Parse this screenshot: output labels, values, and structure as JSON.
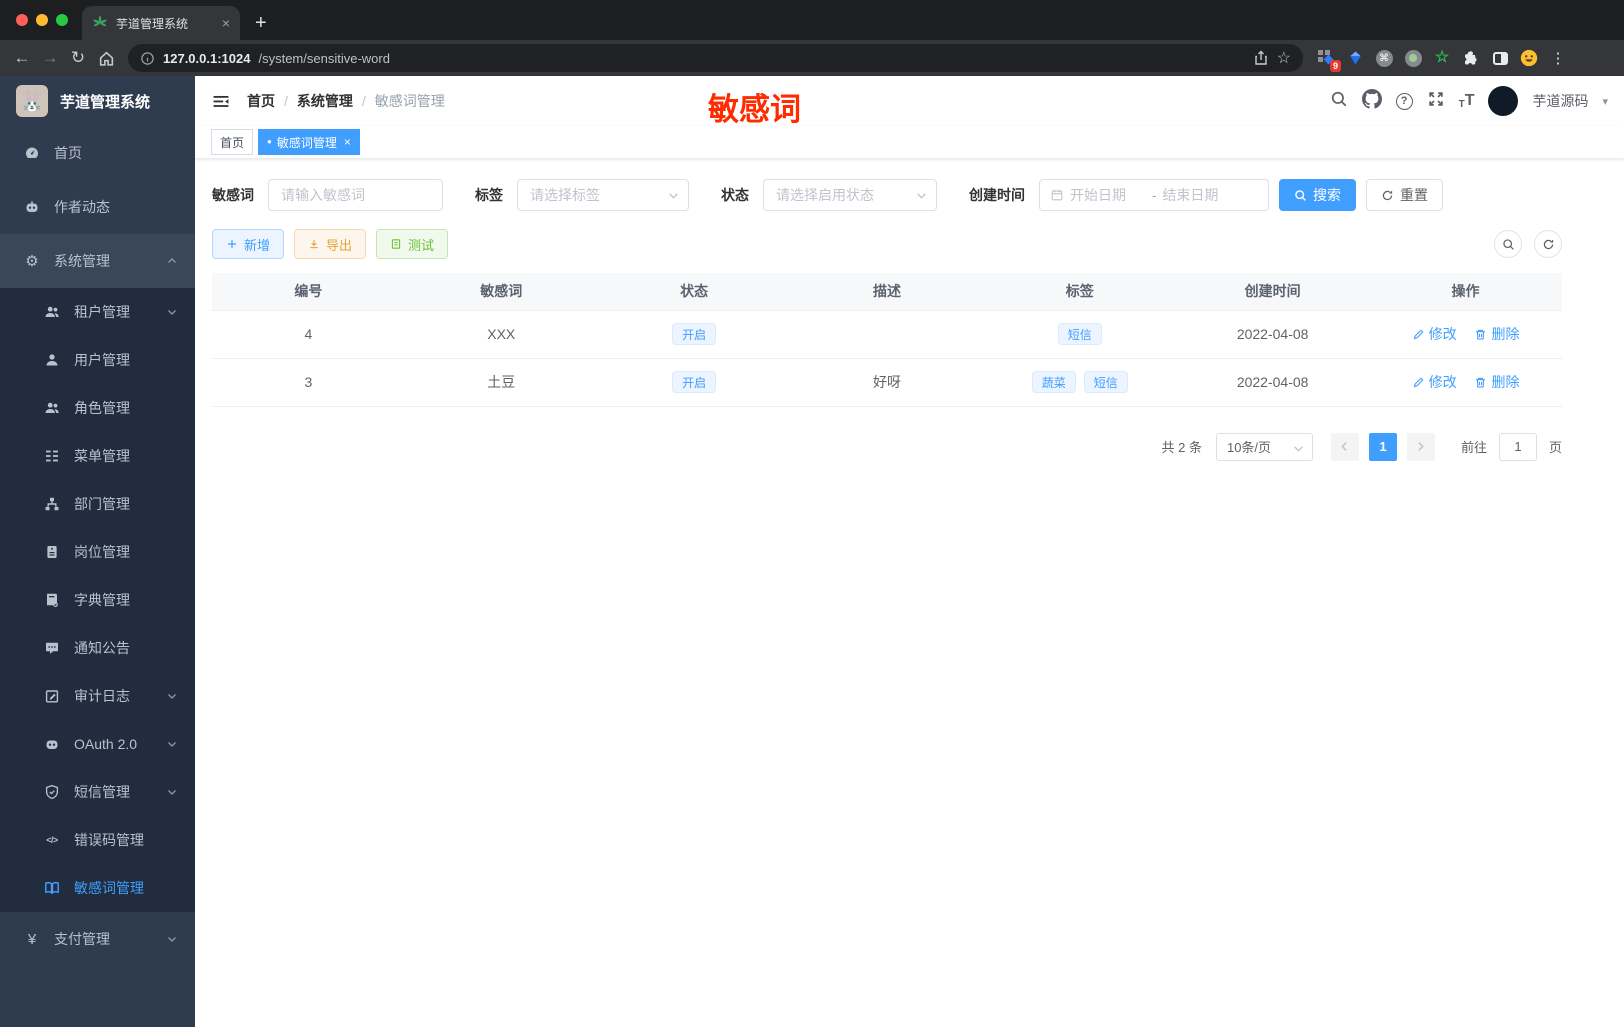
{
  "browser": {
    "tab_title": "芋道管理系统",
    "url_host": "127.0.0.1:1024",
    "url_path": "/system/sensitive-word",
    "extension_badge": "9"
  },
  "icons": {
    "back": "←",
    "forward": "→",
    "reload": "↻",
    "star": "☆",
    "ellipsis": "⋮",
    "new_tab": "+",
    "close": "×",
    "dot": "●",
    "gear": "⚙",
    "yen": "¥",
    "code": "</>",
    "command": "⌘",
    "green_star": "☆",
    "caret_down": "▾",
    "question": "?",
    "font_small": "T",
    "font_large": "T",
    "rabbit": "🐰"
  },
  "sidebar": {
    "app_title": "芋道管理系统",
    "items": [
      {
        "label": "首页"
      },
      {
        "label": "作者动态"
      },
      {
        "label": "系统管理"
      },
      {
        "label": "租户管理"
      },
      {
        "label": "用户管理"
      },
      {
        "label": "角色管理"
      },
      {
        "label": "菜单管理"
      },
      {
        "label": "部门管理"
      },
      {
        "label": "岗位管理"
      },
      {
        "label": "字典管理"
      },
      {
        "label": "通知公告"
      },
      {
        "label": "审计日志"
      },
      {
        "label": "OAuth 2.0"
      },
      {
        "label": "短信管理"
      },
      {
        "label": "错误码管理"
      },
      {
        "label": "敏感词管理"
      },
      {
        "label": "支付管理"
      }
    ]
  },
  "header": {
    "breadcrumb": [
      "首页",
      "系统管理",
      "敏感词管理"
    ],
    "breadcrumb_sep": "/",
    "annotation": "敏感词",
    "user_name": "芋道源码"
  },
  "tabs": [
    {
      "label": "首页"
    },
    {
      "label": "敏感词管理"
    }
  ],
  "filters": {
    "keyword_label": "敏感词",
    "keyword_placeholder": "请输入敏感词",
    "tag_label": "标签",
    "tag_placeholder": "请选择标签",
    "status_label": "状态",
    "status_placeholder": "请选择启用状态",
    "date_label": "创建时间",
    "date_start_placeholder": "开始日期",
    "date_separator": "-",
    "date_end_placeholder": "结束日期",
    "search_label": "搜索",
    "reset_label": "重置"
  },
  "toolbar": {
    "add": "新增",
    "export": "导出",
    "test": "测试"
  },
  "table": {
    "columns": [
      "编号",
      "敏感词",
      "状态",
      "描述",
      "标签",
      "创建时间",
      "操作"
    ],
    "actions": {
      "edit": "修改",
      "delete": "删除"
    },
    "rows": [
      {
        "id": "4",
        "word": "XXX",
        "status": "开启",
        "description": "",
        "tags": [
          "短信"
        ],
        "created": "2022-04-08"
      },
      {
        "id": "3",
        "word": "土豆",
        "status": "开启",
        "description": "好呀",
        "tags": [
          "蔬菜",
          "短信"
        ],
        "created": "2022-04-08"
      }
    ]
  },
  "pagination": {
    "total": "共 2 条",
    "page_size": "10条/页",
    "current_page": "1",
    "goto_label": "前往",
    "goto_value": "1",
    "page_unit": "页"
  },
  "colors": {
    "accent": "#409eff",
    "annotation_red": "#fe2c00",
    "success": "#67c23a",
    "warning": "#e6a23c"
  }
}
